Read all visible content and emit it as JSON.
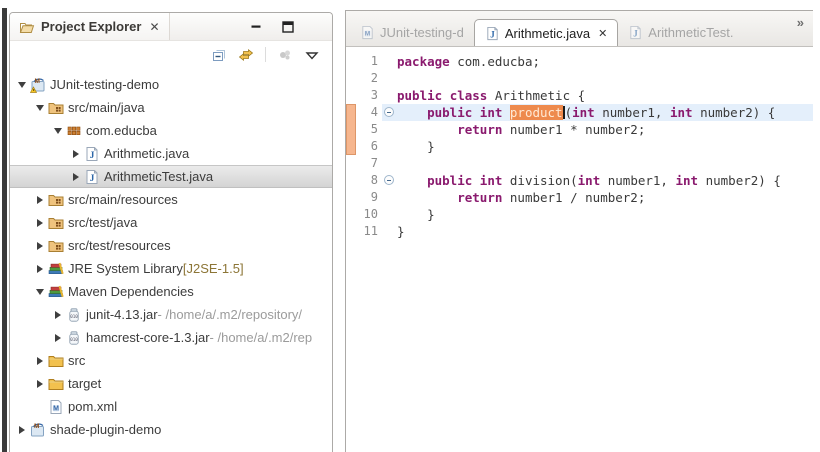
{
  "explorer": {
    "title": "Project Explorer",
    "close_glyph": "✕",
    "window_buttons": [
      "minimize",
      "maximize"
    ],
    "toolbar_icons": [
      "collapse-all",
      "link-with-editor",
      "separator",
      "focus",
      "view-menu"
    ],
    "tree": [
      {
        "level": 0,
        "arrow": "expanded",
        "icon": "maven-project-warning",
        "label": "JUnit-testing-demo"
      },
      {
        "level": 1,
        "arrow": "expanded",
        "icon": "src-folder",
        "label": "src/main/java"
      },
      {
        "level": 2,
        "arrow": "expanded",
        "icon": "package",
        "label": "com.educba"
      },
      {
        "level": 3,
        "arrow": "collapsed",
        "icon": "java-file",
        "label": "Arithmetic.java"
      },
      {
        "level": 3,
        "arrow": "collapsed",
        "icon": "java-file",
        "label": "ArithmeticTest.java",
        "selected": true
      },
      {
        "level": 1,
        "arrow": "collapsed",
        "icon": "src-folder",
        "label": "src/main/resources"
      },
      {
        "level": 1,
        "arrow": "collapsed",
        "icon": "src-folder",
        "label": "src/test/java"
      },
      {
        "level": 1,
        "arrow": "collapsed",
        "icon": "src-folder",
        "label": "src/test/resources"
      },
      {
        "level": 1,
        "arrow": "collapsed",
        "icon": "library",
        "label": "JRE System Library",
        "decoration": " [J2SE-1.5]"
      },
      {
        "level": 1,
        "arrow": "expanded",
        "icon": "library",
        "label": "Maven Dependencies"
      },
      {
        "level": 2,
        "arrow": "collapsed",
        "icon": "jar",
        "label": "junit-4.13.jar",
        "qualifier": " - /home/a/.m2/repository/"
      },
      {
        "level": 2,
        "arrow": "collapsed",
        "icon": "jar",
        "label": "hamcrest-core-1.3.jar",
        "qualifier": " - /home/a/.m2/rep"
      },
      {
        "level": 1,
        "arrow": "collapsed",
        "icon": "folder",
        "label": "src"
      },
      {
        "level": 1,
        "arrow": "collapsed",
        "icon": "folder",
        "label": "target"
      },
      {
        "level": 1,
        "arrow": "none",
        "icon": "pom-file",
        "label": "pom.xml"
      },
      {
        "level": 0,
        "arrow": "collapsed",
        "icon": "maven-project",
        "label": "shade-plugin-demo"
      }
    ]
  },
  "editor": {
    "tabs": [
      {
        "label": "JUnit-testing-d",
        "icon": "m-file",
        "active": false
      },
      {
        "label": "Arithmetic.java",
        "icon": "java-file",
        "active": true,
        "close_glyph": "✕"
      },
      {
        "label": "ArithmeticTest.",
        "icon": "java-file",
        "active": false
      }
    ],
    "overflow_glyph": "»",
    "code": {
      "current_line": 4,
      "fold_lines": [
        4,
        8
      ],
      "marker_range": [
        4,
        6
      ],
      "lines": [
        {
          "n": 1,
          "tokens": [
            [
              "k",
              "package"
            ],
            [
              "p",
              " com.educba;"
            ]
          ]
        },
        {
          "n": 2,
          "tokens": []
        },
        {
          "n": 3,
          "tokens": [
            [
              "k",
              "public"
            ],
            [
              "p",
              " "
            ],
            [
              "k",
              "class"
            ],
            [
              "p",
              " Arithmetic {"
            ]
          ]
        },
        {
          "n": 4,
          "tokens": [
            [
              "p",
              "    "
            ],
            [
              "k",
              "public"
            ],
            [
              "p",
              " "
            ],
            [
              "k",
              "int"
            ],
            [
              "p",
              " "
            ],
            [
              "hl",
              "product"
            ],
            [
              "caret",
              ""
            ],
            [
              "p",
              "("
            ],
            [
              "k",
              "int"
            ],
            [
              "p",
              " number1, "
            ],
            [
              "k",
              "int"
            ],
            [
              "p",
              " number2) {"
            ]
          ]
        },
        {
          "n": 5,
          "tokens": [
            [
              "p",
              "        "
            ],
            [
              "k",
              "return"
            ],
            [
              "p",
              " number1 * number2;"
            ]
          ]
        },
        {
          "n": 6,
          "tokens": [
            [
              "p",
              "    }"
            ]
          ]
        },
        {
          "n": 7,
          "tokens": []
        },
        {
          "n": 8,
          "tokens": [
            [
              "p",
              "    "
            ],
            [
              "k",
              "public"
            ],
            [
              "p",
              " "
            ],
            [
              "k",
              "int"
            ],
            [
              "p",
              " division("
            ],
            [
              "k",
              "int"
            ],
            [
              "p",
              " number1, "
            ],
            [
              "k",
              "int"
            ],
            [
              "p",
              " number2) {"
            ]
          ]
        },
        {
          "n": 9,
          "tokens": [
            [
              "p",
              "        "
            ],
            [
              "k",
              "return"
            ],
            [
              "p",
              " number1 / number2;"
            ]
          ]
        },
        {
          "n": 10,
          "tokens": [
            [
              "p",
              "    }"
            ]
          ]
        },
        {
          "n": 11,
          "tokens": [
            [
              "p",
              "}"
            ]
          ]
        }
      ]
    }
  },
  "colors": {
    "keyword_color": "#8a1a6e",
    "occurrence_bg": "#ee8a4d",
    "occurrence_fg": "#ffe9d4",
    "current_line_bg": "#e4effb",
    "marker_color": "#f6b68e",
    "decoration_color": "#8c7536",
    "qualifier_color": "#9b9b9b",
    "selection_bg": "#d4d4d4"
  }
}
